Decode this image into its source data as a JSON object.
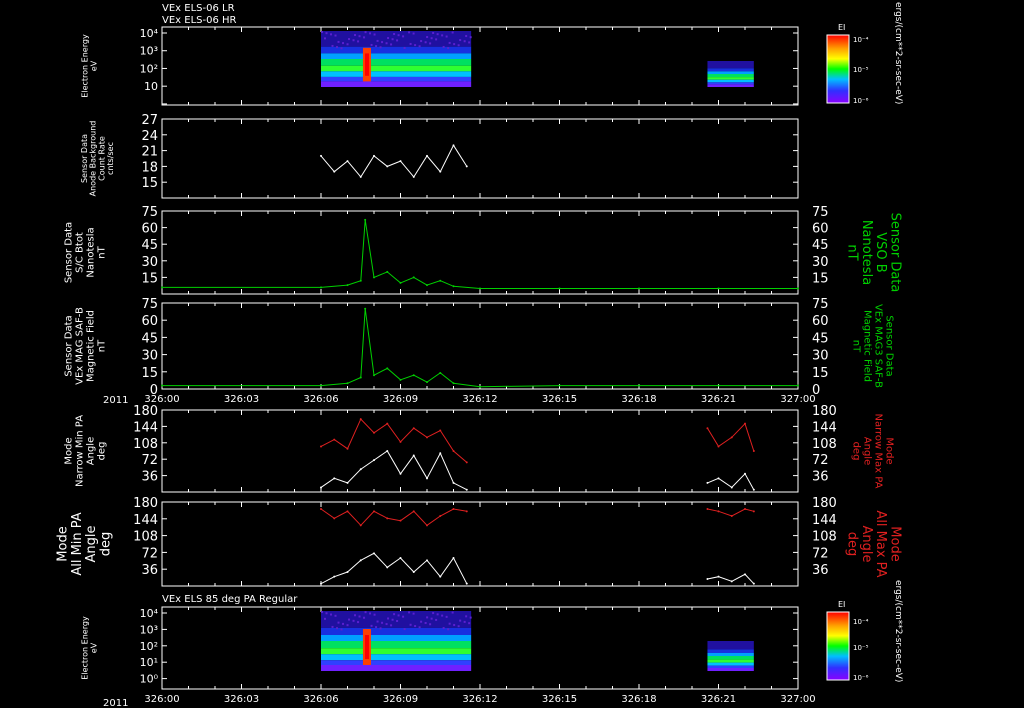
{
  "header": {
    "line1": "VEx ELS-06 LR",
    "line2": "VEx ELS-06 HR",
    "panel7_title": "VEx ELS 85 deg PA Regular"
  },
  "time_axis": {
    "year": "2011",
    "tick_labels": [
      "326:00",
      "326:03",
      "326:06",
      "326:09",
      "326:12",
      "326:15",
      "326:18",
      "326:21",
      "327:00"
    ]
  },
  "colorbar": {
    "title": "EI",
    "tick_labels": [
      "10⁻⁴",
      "10⁻⁵",
      "10⁻⁶"
    ],
    "units": "ergs/(cm**2-sr-sec-eV)"
  },
  "colors": {
    "background": "#000000",
    "axes": "#ffffff",
    "green_series": "#00d000",
    "red_series": "#e02020",
    "white_series": "#ffffff"
  },
  "chart_data": [
    {
      "type": "heatmap",
      "panel": "p1",
      "ylabel": [
        "Electron Energy",
        "eV"
      ],
      "yscale": "log",
      "y_tick_labels": [
        "10⁴",
        "10³",
        "10²",
        "10",
        ""
      ],
      "data_blocks": [
        {
          "x_start": "326:06",
          "x_end": "326:11:40"
        },
        {
          "x_start": "326:20:35",
          "x_end": "326:22:20"
        }
      ]
    },
    {
      "type": "line",
      "panel": "p2",
      "ylabel": [
        "Sensor Data",
        "Anode Background",
        "Count Rate",
        "cnts/sec"
      ],
      "ylim": [
        12,
        27
      ],
      "y_ticks": [
        15,
        18,
        21,
        24,
        27
      ],
      "series": [
        {
          "color": "white",
          "x": [
            "326:06",
            "326:06:30",
            "326:07",
            "326:07:30",
            "326:08",
            "326:08:30",
            "326:09",
            "326:09:30",
            "326:10",
            "326:10:30",
            "326:11",
            "326:11:30"
          ],
          "values": [
            20,
            17,
            19,
            16,
            20,
            18,
            19,
            16,
            20,
            17,
            22,
            18
          ]
        }
      ]
    },
    {
      "type": "line",
      "panel": "p3",
      "ylabel_left": [
        "Sensor Data",
        "S/C Btot",
        "Nanotesla",
        "nT"
      ],
      "ylabel_right": [
        "Sensor Data",
        "VSO B",
        "Nanotesla",
        "nT"
      ],
      "ylim": [
        0,
        75
      ],
      "y_ticks": [
        15,
        30,
        45,
        60,
        75
      ],
      "series": [
        {
          "color": "green",
          "x": [
            "326:00",
            "326:06",
            "326:07",
            "326:07:30",
            "326:07:40",
            "326:08",
            "326:08:30",
            "326:09",
            "326:09:30",
            "326:10",
            "326:10:30",
            "326:11",
            "326:12",
            "326:15",
            "326:18",
            "326:21",
            "327:00"
          ],
          "values": [
            6,
            6,
            8,
            12,
            67,
            15,
            20,
            10,
            15,
            8,
            12,
            7,
            5,
            5,
            5,
            5,
            5
          ]
        }
      ]
    },
    {
      "type": "line",
      "panel": "p4",
      "ylabel_left": [
        "Sensor Data",
        "VEx MAG SAF-B",
        "Magnetic Field",
        "nT"
      ],
      "ylabel_right": [
        "Sensor Data",
        "VEx MAG3 SAF-B",
        "Magnetic Field",
        "nT"
      ],
      "ylim": [
        0,
        75
      ],
      "y_ticks": [
        0,
        15,
        30,
        45,
        60,
        75
      ],
      "series": [
        {
          "color": "green",
          "x": [
            "326:00",
            "326:06",
            "326:07",
            "326:07:30",
            "326:07:40",
            "326:08",
            "326:08:30",
            "326:09",
            "326:09:30",
            "326:10",
            "326:10:30",
            "326:11",
            "326:12",
            "326:15",
            "326:18",
            "326:21",
            "327:00"
          ],
          "values": [
            3,
            3,
            5,
            10,
            70,
            12,
            18,
            8,
            12,
            6,
            14,
            5,
            2,
            3,
            3,
            3,
            3
          ]
        }
      ]
    },
    {
      "type": "line",
      "panel": "p5",
      "ylabel_left": [
        "Mode",
        "Narrow Min PA",
        "Angle",
        "deg"
      ],
      "ylabel_right": [
        "Mode",
        "Narrow Max PA",
        "Angle",
        "deg"
      ],
      "ylim": [
        0,
        180
      ],
      "y_ticks": [
        36,
        72,
        108,
        144,
        180
      ],
      "series": [
        {
          "color": "red",
          "x": [
            "326:06",
            "326:06:30",
            "326:07",
            "326:07:30",
            "326:08",
            "326:08:30",
            "326:09",
            "326:09:30",
            "326:10",
            "326:10:30",
            "326:11",
            "326:11:30",
            "326:20:35",
            "326:21",
            "326:21:30",
            "326:22",
            "326:22:20"
          ],
          "values": [
            100,
            115,
            95,
            160,
            130,
            150,
            110,
            140,
            120,
            135,
            90,
            65,
            140,
            100,
            120,
            150,
            90
          ]
        },
        {
          "color": "white",
          "x": [
            "326:06",
            "326:06:30",
            "326:07",
            "326:07:30",
            "326:08",
            "326:08:30",
            "326:09",
            "326:09:30",
            "326:10",
            "326:10:30",
            "326:11",
            "326:11:30",
            "326:20:35",
            "326:21",
            "326:21:30",
            "326:22",
            "326:22:20"
          ],
          "values": [
            10,
            30,
            20,
            50,
            70,
            90,
            40,
            80,
            30,
            85,
            20,
            5,
            20,
            30,
            10,
            40,
            5
          ]
        }
      ]
    },
    {
      "type": "line",
      "panel": "p6",
      "ylabel_left": [
        "Mode",
        "All Min PA",
        "Angle",
        "deg"
      ],
      "ylabel_right": [
        "Mode",
        "All Max PA",
        "Angle",
        "deg"
      ],
      "ylim": [
        0,
        180
      ],
      "y_ticks": [
        36,
        72,
        108,
        144,
        180
      ],
      "series": [
        {
          "color": "red",
          "x": [
            "326:06",
            "326:06:30",
            "326:07",
            "326:07:30",
            "326:08",
            "326:08:30",
            "326:09",
            "326:09:30",
            "326:10",
            "326:10:30",
            "326:11",
            "326:11:30",
            "326:20:35",
            "326:21",
            "326:21:30",
            "326:22",
            "326:22:20"
          ],
          "values": [
            165,
            145,
            160,
            130,
            160,
            145,
            140,
            160,
            130,
            150,
            165,
            160,
            165,
            160,
            150,
            165,
            160
          ]
        },
        {
          "color": "white",
          "x": [
            "326:06",
            "326:06:30",
            "326:07",
            "326:07:30",
            "326:08",
            "326:08:30",
            "326:09",
            "326:09:30",
            "326:10",
            "326:10:30",
            "326:11",
            "326:11:30",
            "326:20:35",
            "326:21",
            "326:21:30",
            "326:22",
            "326:22:20"
          ],
          "values": [
            5,
            20,
            30,
            55,
            70,
            40,
            60,
            30,
            55,
            20,
            60,
            5,
            15,
            20,
            10,
            25,
            5
          ]
        }
      ]
    },
    {
      "type": "heatmap",
      "panel": "p7",
      "title": "VEx ELS 85 deg PA Regular",
      "ylabel": [
        "Electron Energy",
        "eV"
      ],
      "yscale": "log",
      "y_tick_labels": [
        "10⁴",
        "10³",
        "10²",
        "10¹",
        "10⁰",
        "10⁻¹"
      ],
      "data_blocks": [
        {
          "x_start": "326:06",
          "x_end": "326:11:40"
        },
        {
          "x_start": "326:20:35",
          "x_end": "326:22:20"
        }
      ]
    }
  ]
}
